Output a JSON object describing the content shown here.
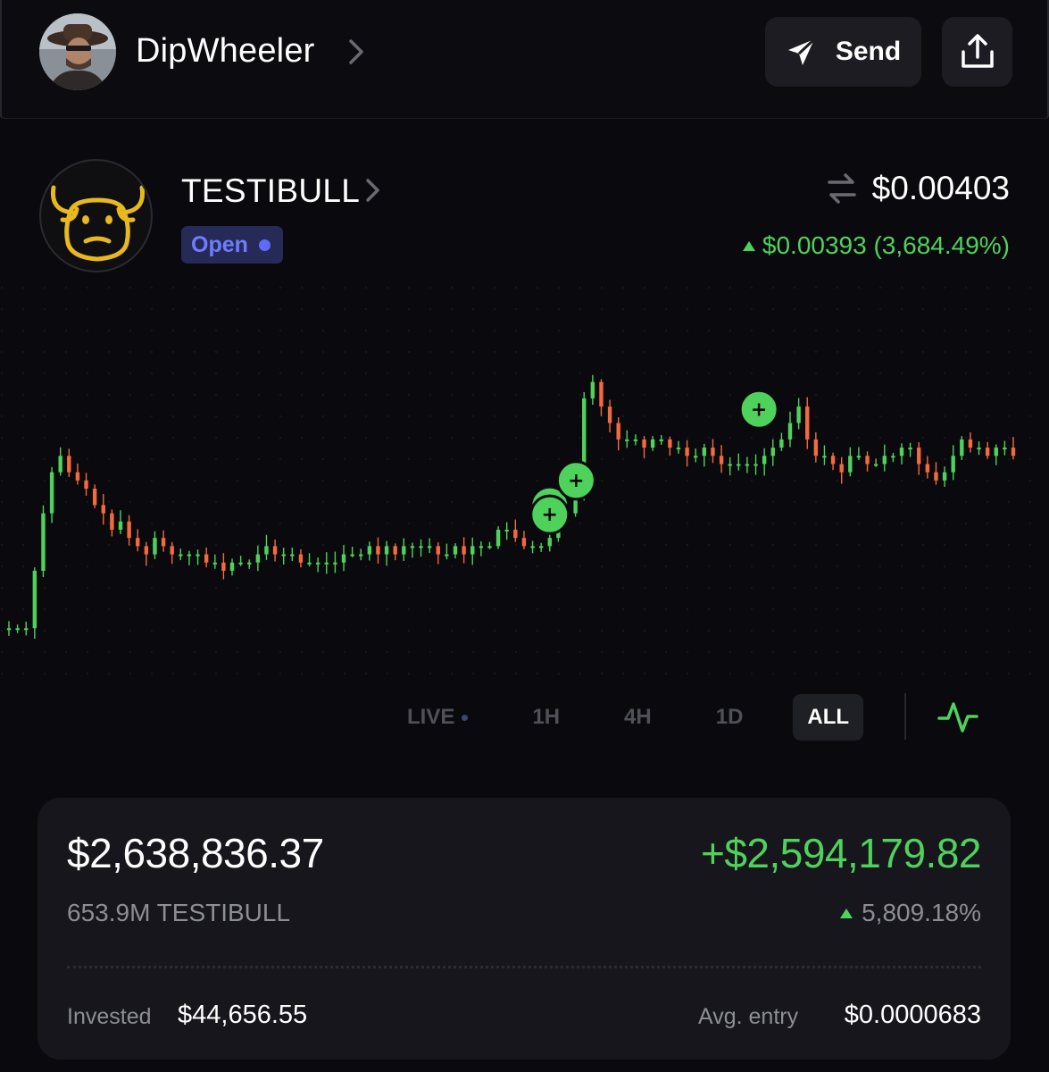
{
  "header": {
    "username": "DipWheeler",
    "send_label": "Send",
    "icons": {
      "avatar": "user-avatar",
      "chevron": "chevron-right-icon",
      "send": "paper-plane-icon",
      "share": "share-upload-icon"
    }
  },
  "token": {
    "symbol": "TESTIBULL",
    "status": "Open",
    "price": "$0.00403",
    "change": "$0.00393 (3,684.49%)",
    "colors": {
      "up": "#4fd25b",
      "down": "#f26a3d",
      "badge_text": "#6f7cff"
    }
  },
  "chart_data": {
    "type": "candlestick",
    "x_axis": "time",
    "y_axis": "price",
    "values": [
      0.0012,
      0.0012,
      0.0012,
      0.0019,
      0.0026,
      0.0031,
      0.0033,
      0.0031,
      0.003,
      0.0029,
      0.0027,
      0.0026,
      0.0024,
      0.0025,
      0.0023,
      0.0022,
      0.0021,
      0.0023,
      0.0022,
      0.0021,
      0.0021,
      0.0021,
      0.0021,
      0.002,
      0.002,
      0.0019,
      0.002,
      0.002,
      0.002,
      0.0021,
      0.0022,
      0.0021,
      0.0021,
      0.0021,
      0.002,
      0.002,
      0.002,
      0.002,
      0.002,
      0.0021,
      0.0021,
      0.0021,
      0.0022,
      0.0021,
      0.0022,
      0.0021,
      0.0022,
      0.0022,
      0.0022,
      0.0022,
      0.0021,
      0.0021,
      0.0022,
      0.0021,
      0.0022,
      0.0022,
      0.0022,
      0.0024,
      0.0024,
      0.0023,
      0.0022,
      0.0022,
      0.0022,
      0.0023,
      0.0025,
      0.0026,
      0.0028,
      0.004,
      0.0042,
      0.0039,
      0.0037,
      0.0035,
      0.0035,
      0.0035,
      0.0034,
      0.0035,
      0.0035,
      0.0034,
      0.0034,
      0.0033,
      0.0033,
      0.0034,
      0.0033,
      0.0032,
      0.0032,
      0.0032,
      0.0032,
      0.0032,
      0.0033,
      0.0034,
      0.0035,
      0.0037,
      0.0039,
      0.0035,
      0.0033,
      0.0033,
      0.0032,
      0.0031,
      0.0033,
      0.0033,
      0.0032,
      0.0032,
      0.0033,
      0.0033,
      0.0034,
      0.0034,
      0.0032,
      0.0031,
      0.003,
      0.0031,
      0.0033,
      0.0035,
      0.0034,
      0.0034,
      0.0033,
      0.0034,
      0.0034,
      0.0033
    ],
    "markers": [
      {
        "label": "+",
        "type": "buy"
      },
      {
        "label": "+",
        "type": "buy"
      },
      {
        "label": "+",
        "type": "buy"
      },
      {
        "label": "+",
        "type": "buy"
      }
    ]
  },
  "timeframes": {
    "items": [
      {
        "label": "LIVE",
        "active": false,
        "has_dot": true
      },
      {
        "label": "1H",
        "active": false
      },
      {
        "label": "4H",
        "active": false
      },
      {
        "label": "1D",
        "active": false
      },
      {
        "label": "ALL",
        "active": true
      }
    ],
    "chart_type_icon": "activity-line-icon"
  },
  "position": {
    "value": "$2,638,836.37",
    "pnl": "+$2,594,179.82",
    "amount": "653.9M TESTIBULL",
    "pnl_pct": "5,809.18%",
    "invested_label": "Invested",
    "invested_value": "$44,656.55",
    "avg_entry_label": "Avg. entry",
    "avg_entry_value": "$0.0000683"
  }
}
